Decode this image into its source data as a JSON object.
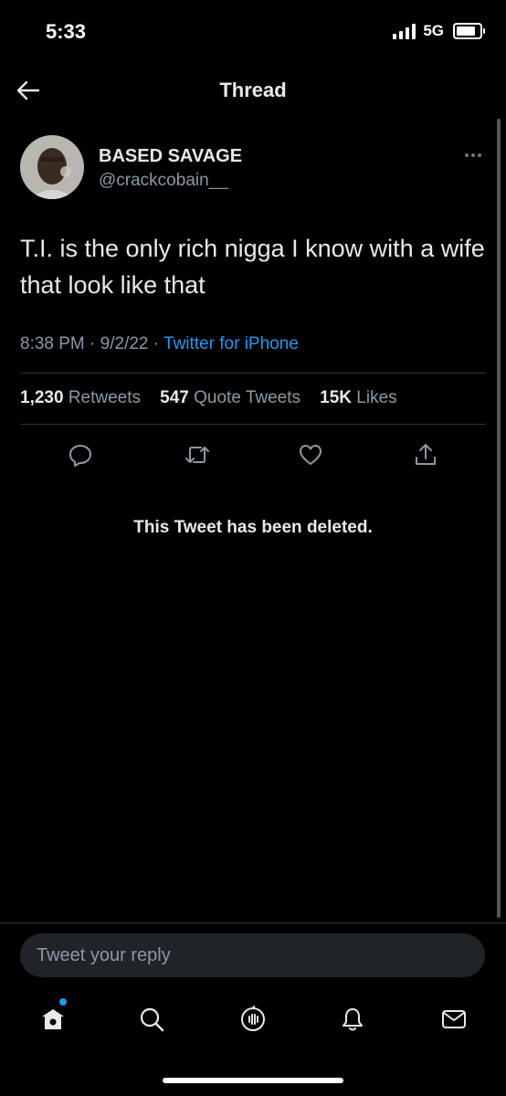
{
  "status_bar": {
    "time": "5:33",
    "network": "5G",
    "battery_level": 0.85
  },
  "header": {
    "title": "Thread",
    "back_icon": "arrow-left-icon"
  },
  "tweet": {
    "author_name": "BASED SAVAGE",
    "author_handle": "@crackcobain__",
    "text": "T.I. is the only rich nigga I know with a wife that look like that",
    "time": "8:38 PM",
    "date": "9/2/22",
    "source": "Twitter for iPhone",
    "retweets_count": "1,230",
    "retweets_label": "Retweets",
    "quotes_count": "547",
    "quotes_label": "Quote Tweets",
    "likes_count": "15K",
    "likes_label": "Likes"
  },
  "actions": [
    "reply-icon",
    "retweet-icon",
    "like-icon",
    "share-icon"
  ],
  "deleted_notice": "This Tweet has been deleted.",
  "reply": {
    "placeholder": "Tweet your reply"
  },
  "tabs": [
    "home-icon",
    "search-icon",
    "spaces-icon",
    "notifications-icon",
    "messages-icon"
  ],
  "colors": {
    "accent": "#1d9bf0",
    "background": "#000000",
    "secondary_text": "#8b98a5",
    "divider": "#2f3336"
  }
}
